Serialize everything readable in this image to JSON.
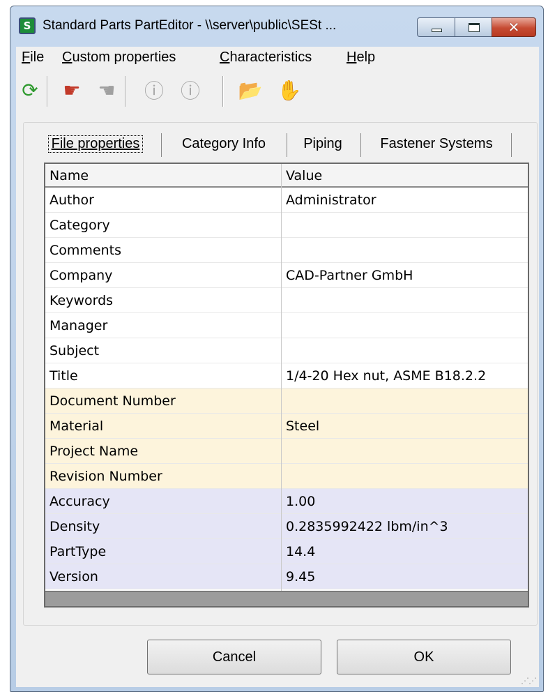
{
  "window": {
    "title": "Standard Parts PartEditor - \\\\server\\public\\SESt ...",
    "app_icon": "S"
  },
  "titlebar_buttons": {
    "close_glyph": "✕"
  },
  "menu": [
    {
      "mnemonic": "F",
      "rest": "ile"
    },
    {
      "mnemonic": "C",
      "rest": "ustom properties"
    },
    {
      "mnemonic": "C",
      "rest": "haracteristics"
    },
    {
      "mnemonic": "H",
      "rest": "elp"
    }
  ],
  "toolbar": {
    "icons": [
      "refresh-icon",
      "hand-import-icon",
      "hand-export-icon",
      "info-add-icon",
      "info-remove-icon",
      "open-folder-icon",
      "gray-hand-icon"
    ],
    "glyphs": [
      "⟳",
      "☛",
      "☚",
      "ⓘ",
      "ⓘ",
      "📂",
      "✋"
    ]
  },
  "tabs": [
    "File properties",
    "Category Info",
    "Piping",
    "Fastener Systems"
  ],
  "grid": {
    "headers": {
      "name": "Name",
      "value": "Value"
    },
    "rows": [
      {
        "name": "Author",
        "value": "Administrator",
        "group": "std"
      },
      {
        "name": "Category",
        "value": "",
        "group": "std"
      },
      {
        "name": "Comments",
        "value": "",
        "group": "std"
      },
      {
        "name": "Company",
        "value": "CAD-Partner GmbH",
        "group": "std"
      },
      {
        "name": "Keywords",
        "value": "",
        "group": "std"
      },
      {
        "name": "Manager",
        "value": "",
        "group": "std"
      },
      {
        "name": "Subject",
        "value": "",
        "group": "std"
      },
      {
        "name": "Title",
        "value": "1/4-20 Hex nut, ASME B18.2.2",
        "group": "std"
      },
      {
        "name": "Document Number",
        "value": "",
        "group": "custom"
      },
      {
        "name": "Material",
        "value": "Steel",
        "group": "custom"
      },
      {
        "name": "Project Name",
        "value": "",
        "group": "custom"
      },
      {
        "name": "Revision Number",
        "value": "",
        "group": "custom"
      },
      {
        "name": "Accuracy",
        "value": "1.00",
        "group": "chars"
      },
      {
        "name": "Density",
        "value": "0.2835992422 lbm/in^3",
        "group": "chars"
      },
      {
        "name": "PartType",
        "value": "14.4",
        "group": "chars"
      },
      {
        "name": "Version",
        "value": "9.45",
        "group": "chars"
      }
    ]
  },
  "buttons": {
    "cancel": "Cancel",
    "ok": "OK"
  },
  "colors": {
    "standard_row": "#ffffff",
    "custom_row": "#fdf4dc",
    "characteristics_row": "#e5e5f6"
  }
}
